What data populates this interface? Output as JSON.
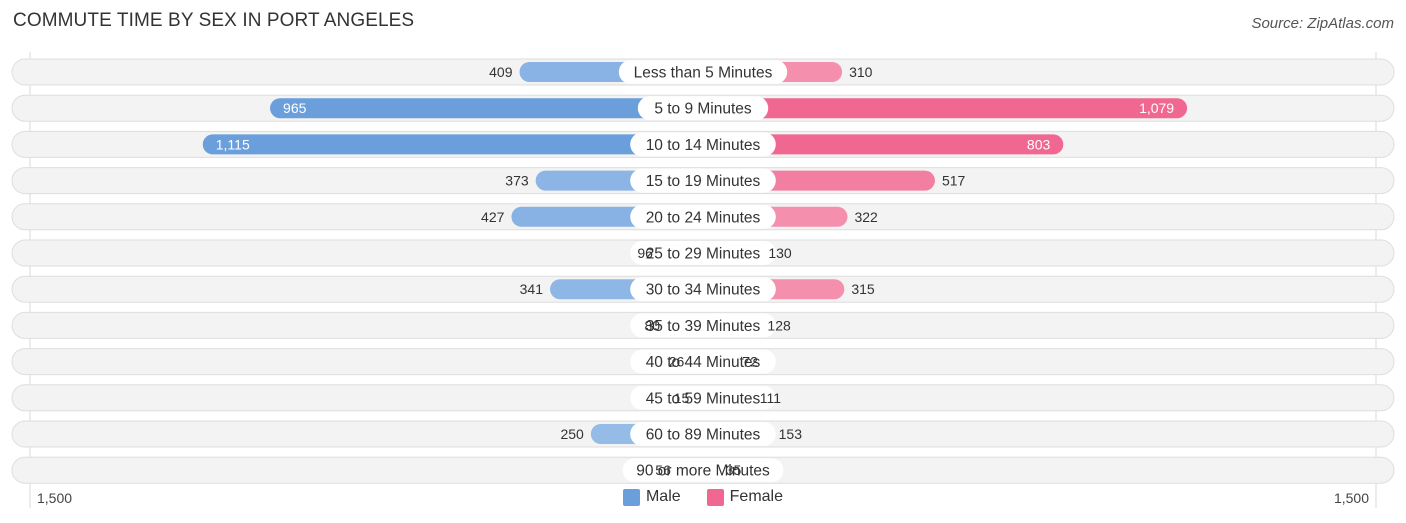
{
  "chart_data": {
    "type": "bar",
    "orientation": "horizontal-diverging",
    "title": "COMMUTE TIME BY SEX IN PORT ANGELES",
    "source": "Source: ZipAtlas.com",
    "categories": [
      "Less than 5 Minutes",
      "5 to 9 Minutes",
      "10 to 14 Minutes",
      "15 to 19 Minutes",
      "20 to 24 Minutes",
      "25 to 29 Minutes",
      "30 to 34 Minutes",
      "35 to 39 Minutes",
      "40 to 44 Minutes",
      "45 to 59 Minutes",
      "60 to 89 Minutes",
      "90 or more Minutes"
    ],
    "series": [
      {
        "name": "Male",
        "color": "#6a9fdc",
        "values": [
          409,
          965,
          1115,
          373,
          427,
          96,
          341,
          80,
          26,
          15,
          250,
          56
        ]
      },
      {
        "name": "Female",
        "color": "#f06892",
        "values": [
          310,
          1079,
          803,
          517,
          322,
          130,
          315,
          128,
          72,
          111,
          153,
          35
        ]
      }
    ],
    "value_labels": {
      "male": [
        "409",
        "965",
        "1,115",
        "373",
        "427",
        "96",
        "341",
        "80",
        "26",
        "15",
        "250",
        "56"
      ],
      "female": [
        "310",
        "1,079",
        "803",
        "517",
        "322",
        "130",
        "315",
        "128",
        "72",
        "111",
        "153",
        "35"
      ]
    },
    "xlim": [
      -1500,
      1500
    ],
    "axis_ticks": {
      "left": "1,500",
      "right": "1,500"
    },
    "legend": {
      "position": "bottom-center",
      "items": [
        "Male",
        "Female"
      ]
    },
    "grid": false
  },
  "colors": {
    "male_strong": "#6a9fdc",
    "male_light": "#a9c8ec",
    "female_strong": "#f06892",
    "female_light": "#f7a9c0",
    "track": "#f3f3f3"
  }
}
